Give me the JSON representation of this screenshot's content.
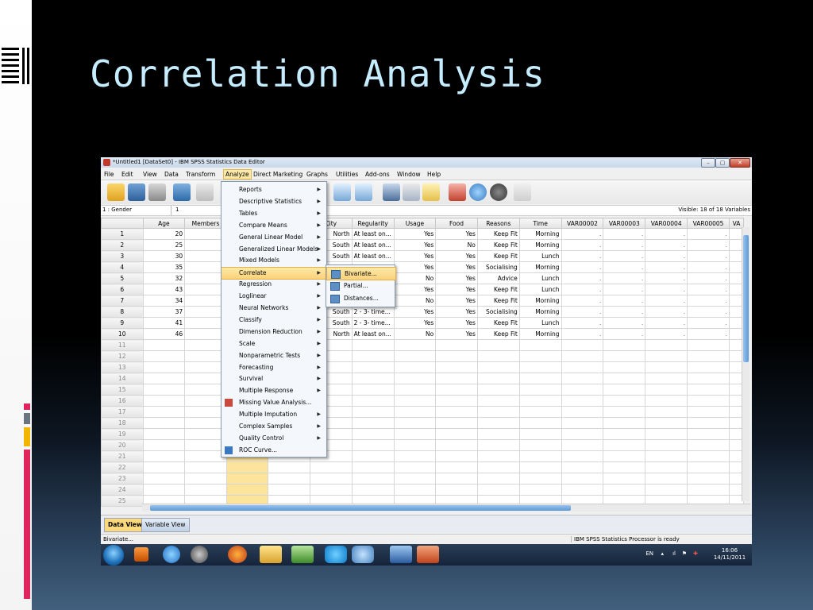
{
  "slide": {
    "title": "Correlation Analysis"
  },
  "window": {
    "title": "*Untitled1 [DataSet0] - IBM SPSS Statistics Data Editor",
    "buttons": {
      "minimize": "–",
      "maximize": "▢",
      "close": "✕"
    }
  },
  "menubar": {
    "items": [
      "File",
      "Edit",
      "View",
      "Data",
      "Transform",
      "Analyze",
      "Direct Marketing",
      "Graphs",
      "Utilities",
      "Add-ons",
      "Window",
      "Help"
    ],
    "active": "Analyze"
  },
  "cellbar": {
    "ref": "1 : Gender",
    "value": "1",
    "visible": "Visible: 18 of 18 Variables"
  },
  "grid": {
    "columns": [
      "",
      "Age",
      "Members",
      "",
      "",
      "City",
      "Regularity",
      "Usage",
      "Food",
      "Reasons",
      "Time",
      "VAR00002",
      "VAR00003",
      "VAR00004",
      "VAR00005",
      "VA"
    ],
    "rows": [
      {
        "n": "1",
        "age": "20",
        "city": "North",
        "reg": "At least on...",
        "usage": "Yes",
        "food": "Yes",
        "reason": "Keep Fit",
        "time": "Morning"
      },
      {
        "n": "2",
        "age": "25",
        "city": "South",
        "reg": "At least on...",
        "usage": "Yes",
        "food": "No",
        "reason": "Keep Fit",
        "time": "Morning"
      },
      {
        "n": "3",
        "age": "30",
        "city": "South",
        "reg": "At least on...",
        "usage": "Yes",
        "food": "Yes",
        "reason": "Keep Fit",
        "time": "Lunch"
      },
      {
        "n": "4",
        "age": "35",
        "city": "",
        "reg": "",
        "usage": "Yes",
        "food": "Yes",
        "reason": "Socialising",
        "time": "Morning"
      },
      {
        "n": "5",
        "age": "32",
        "city": "",
        "reg": "",
        "usage": "No",
        "food": "Yes",
        "reason": "Advice",
        "time": "Lunch"
      },
      {
        "n": "6",
        "age": "43",
        "city": "",
        "reg": "",
        "usage": "Yes",
        "food": "Yes",
        "reason": "Keep Fit",
        "time": "Lunch"
      },
      {
        "n": "7",
        "age": "34",
        "city": "",
        "reg": "",
        "usage": "No",
        "food": "Yes",
        "reason": "Keep Fit",
        "time": "Morning"
      },
      {
        "n": "8",
        "age": "37",
        "city": "South",
        "reg": "2 - 3- time...",
        "usage": "Yes",
        "food": "Yes",
        "reason": "Socialising",
        "time": "Morning"
      },
      {
        "n": "9",
        "age": "41",
        "city": "South",
        "reg": "2 - 3- time...",
        "usage": "Yes",
        "food": "Yes",
        "reason": "Keep Fit",
        "time": "Lunch"
      },
      {
        "n": "10",
        "age": "46",
        "city": "North",
        "reg": "At least on...",
        "usage": "No",
        "food": "Yes",
        "reason": "Keep Fit",
        "time": "Morning"
      }
    ],
    "empty_rows": [
      "11",
      "12",
      "13",
      "14",
      "15",
      "16",
      "17",
      "18",
      "19",
      "20",
      "21",
      "22",
      "23",
      "24",
      "25"
    ],
    "missing": "."
  },
  "analyze_menu": {
    "items": [
      {
        "label": "Reports",
        "sub": true
      },
      {
        "label": "Descriptive Statistics",
        "sub": true
      },
      {
        "label": "Tables",
        "sub": true
      },
      {
        "label": "Compare Means",
        "sub": true
      },
      {
        "label": "General Linear Model",
        "sub": true
      },
      {
        "label": "Generalized Linear Models",
        "sub": true
      },
      {
        "label": "Mixed Models",
        "sub": true
      },
      {
        "label": "Correlate",
        "sub": true
      },
      {
        "label": "Regression",
        "sub": true
      },
      {
        "label": "Loglinear",
        "sub": true
      },
      {
        "label": "Neural Networks",
        "sub": true
      },
      {
        "label": "Classify",
        "sub": true
      },
      {
        "label": "Dimension Reduction",
        "sub": true
      },
      {
        "label": "Scale",
        "sub": true
      },
      {
        "label": "Nonparametric Tests",
        "sub": true
      },
      {
        "label": "Forecasting",
        "sub": true
      },
      {
        "label": "Survival",
        "sub": true
      },
      {
        "label": "Multiple Response",
        "sub": true
      },
      {
        "label": "Missing Value Analysis...",
        "sub": false
      },
      {
        "label": "Multiple Imputation",
        "sub": true
      },
      {
        "label": "Complex Samples",
        "sub": true
      },
      {
        "label": "Quality Control",
        "sub": true
      },
      {
        "label": "ROC Curve...",
        "sub": false
      }
    ],
    "selected": "Correlate"
  },
  "correlate_menu": {
    "items": [
      "Bivariate...",
      "Partial...",
      "Distances..."
    ],
    "selected": "Bivariate..."
  },
  "tabs": {
    "data_view": "Data View",
    "variable_view": "Variable View"
  },
  "status": {
    "left": "Bivariate...",
    "right": "IBM SPSS Statistics Processor is ready"
  },
  "tray": {
    "lang": "EN",
    "time": "16:06",
    "date": "14/11/2011"
  },
  "colors": {
    "title": "#c6ecff",
    "accent_red": "#e0245e",
    "accent_yellow": "#f2b600",
    "accent_gray": "#6a7580"
  }
}
